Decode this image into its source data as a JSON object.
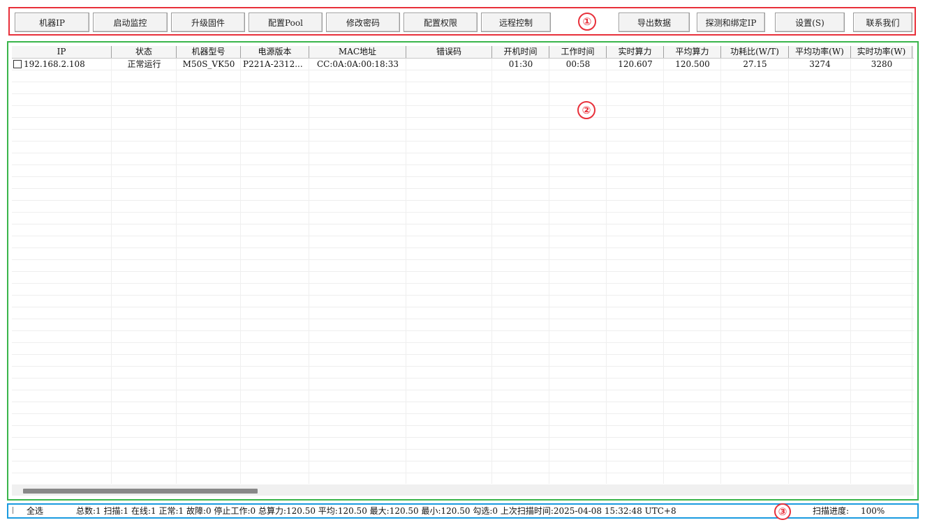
{
  "toolbar": {
    "buttons": [
      {
        "label": "机器IP"
      },
      {
        "label": "启动监控"
      },
      {
        "label": "升级固件"
      },
      {
        "label": "配置Pool"
      },
      {
        "label": "修改密码"
      },
      {
        "label": "配置权限"
      },
      {
        "label": "远程控制"
      },
      {
        "label": "导出数据"
      },
      {
        "label": "探测和绑定IP"
      },
      {
        "label": "设置(S)"
      },
      {
        "label": "联系我们"
      }
    ]
  },
  "annotations": {
    "one": "①",
    "two": "②",
    "three": "③",
    "color_toolbar": "#e8303a",
    "color_table": "#39b54a",
    "color_status": "#1a9be0"
  },
  "table": {
    "columns": [
      "IP",
      "状态",
      "机器型号",
      "电源版本",
      "MAC地址",
      "错误码",
      "开机时间",
      "工作时间",
      "实时算力",
      "平均算力",
      "功耗比(W/T)",
      "平均功率(W)",
      "实时功率(W)"
    ],
    "rows": [
      {
        "checked": false,
        "ip": "192.168.2.108",
        "status": "正常运行",
        "model": "M50S_VK50",
        "power_version": "P221A-2312...",
        "mac": "CC:0A:0A:00:18:33",
        "error_code": "",
        "boot_time": "01:30",
        "work_time": "00:58",
        "realtime_hashrate": "120.607",
        "avg_hashrate": "120.500",
        "efficiency": "27.15",
        "avg_power": "3274",
        "realtime_power": "3280"
      }
    ]
  },
  "statusbar": {
    "select_all_label": "全选",
    "summary": "总数:1 扫描:1 在线:1 正常:1 故障:0 停止工作:0 总算力:120.50 平均:120.50 最大:120.50 最小:120.50 勾选:0 上次扫描时间:2025-04-08 15:32:48 UTC+8",
    "progress_label": "扫描进度:",
    "progress_value": "100%"
  }
}
